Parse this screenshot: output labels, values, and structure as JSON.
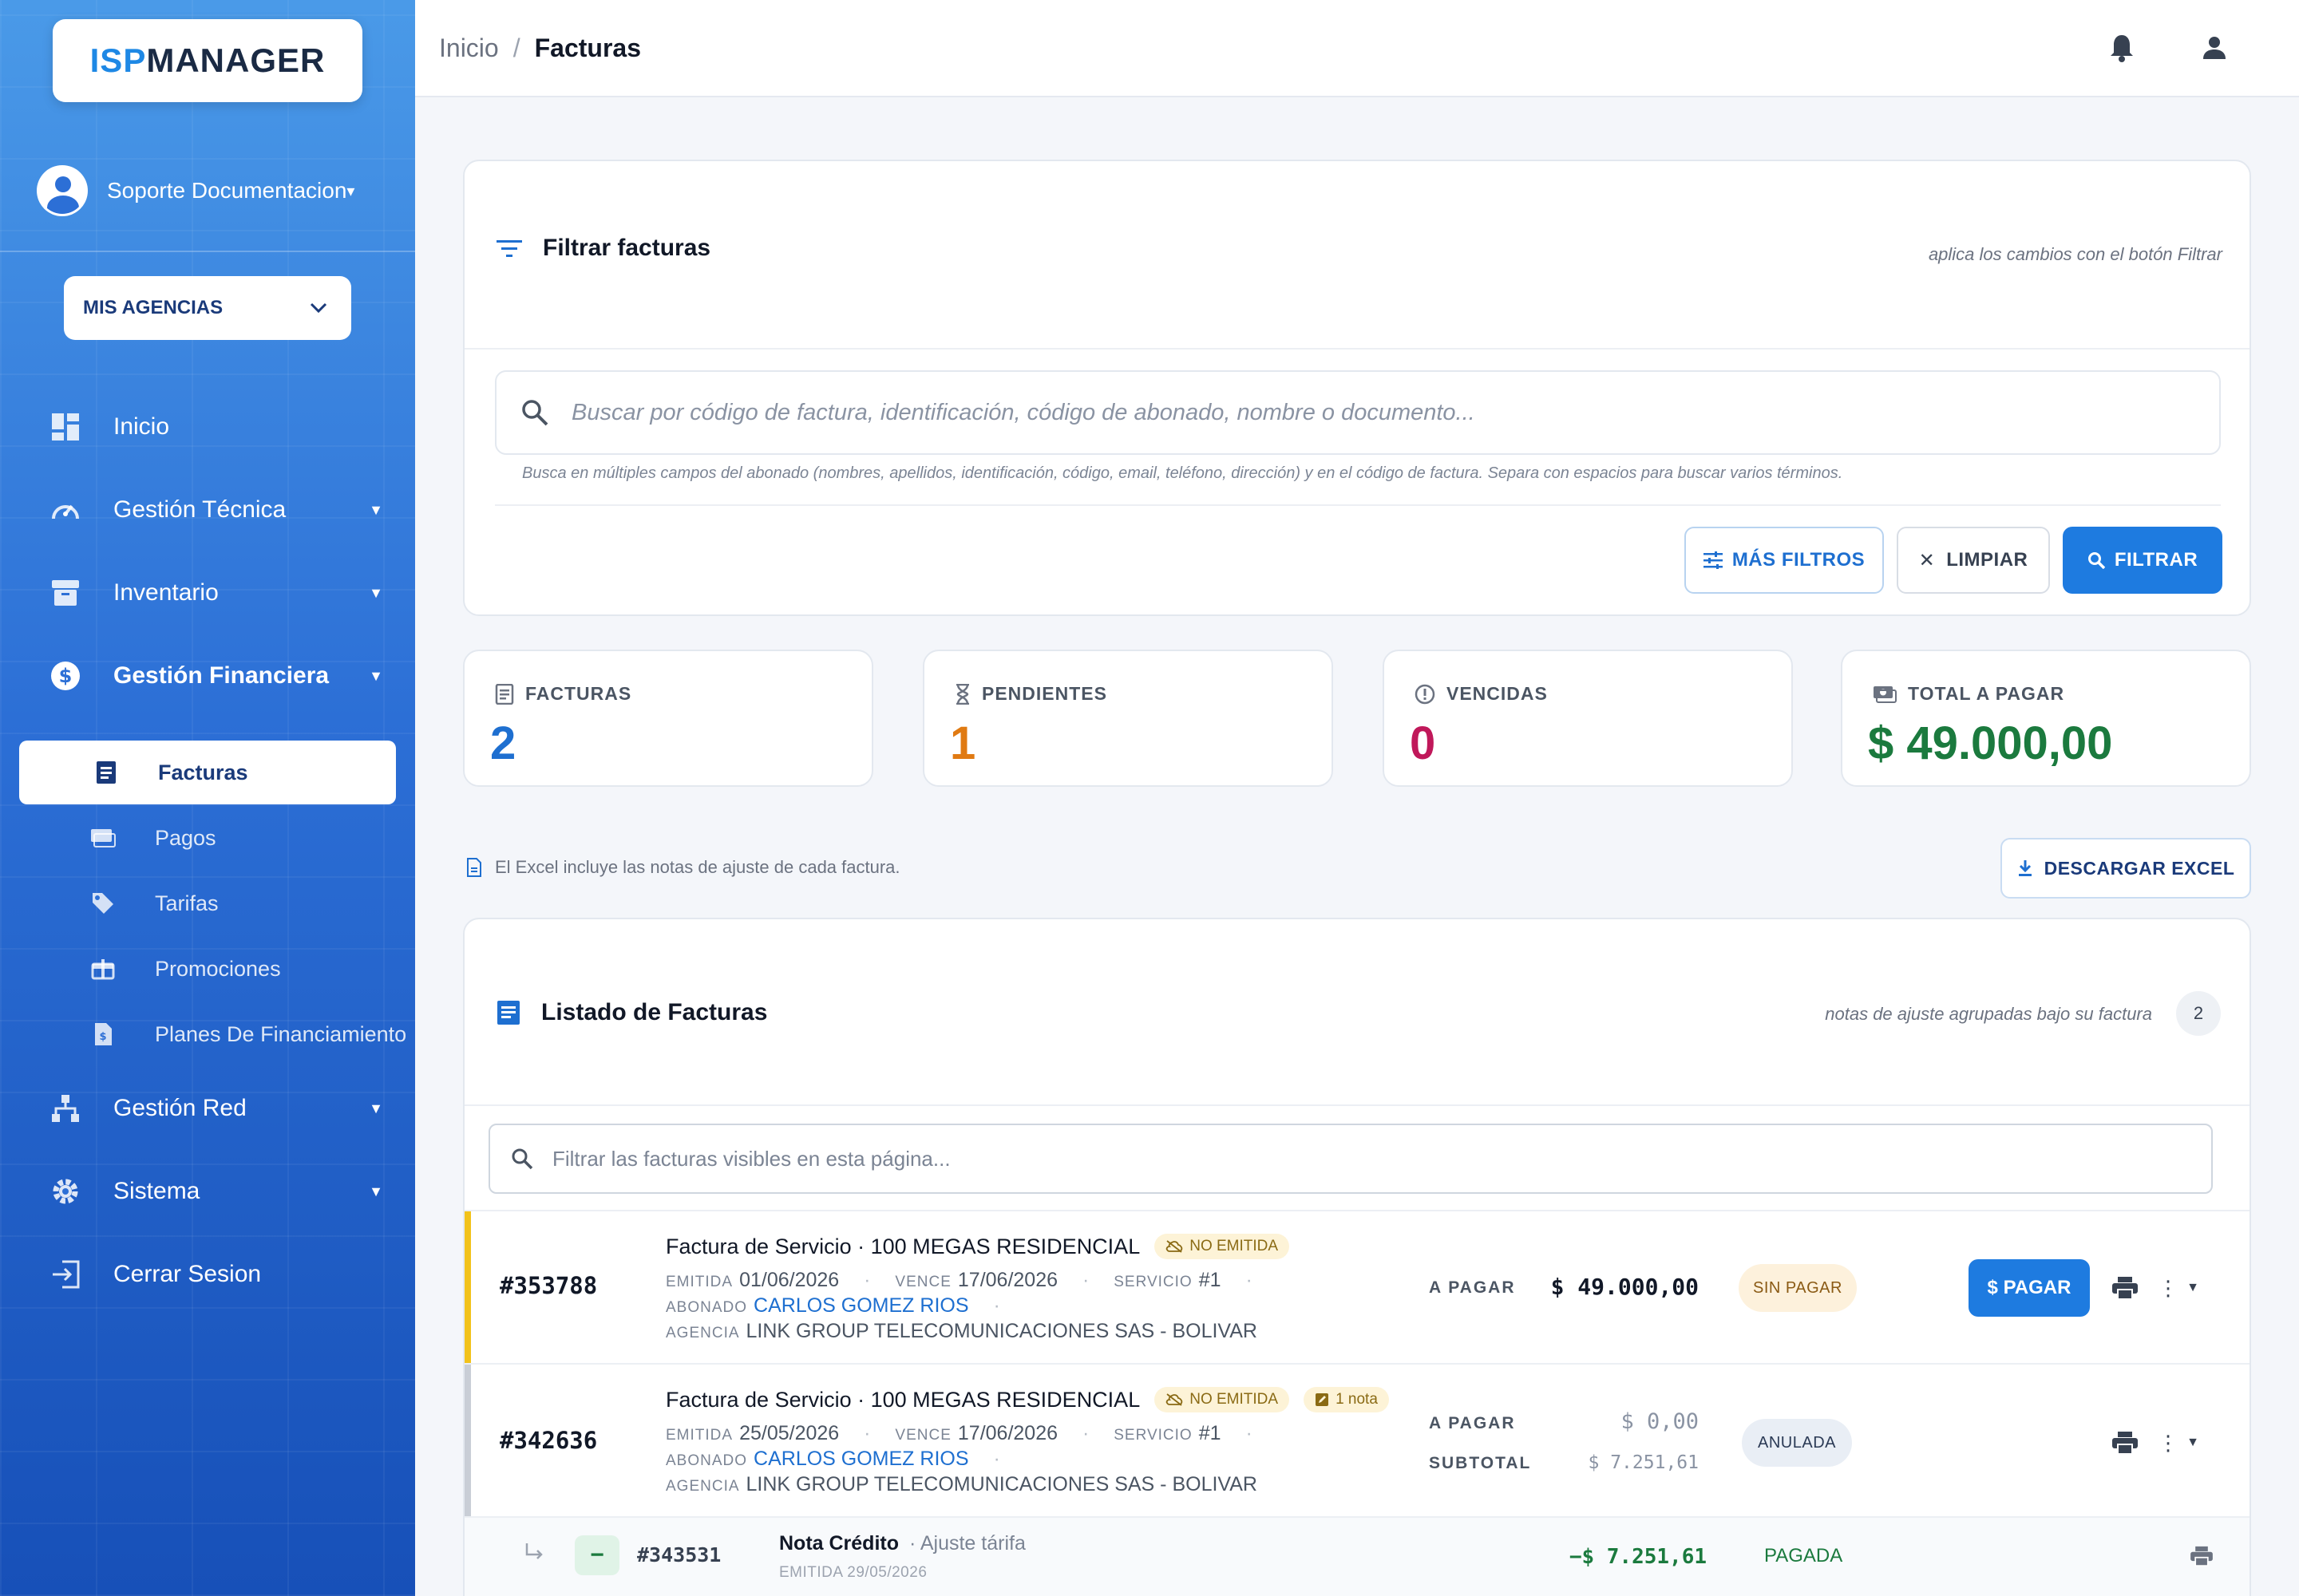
{
  "brand": {
    "logo_part1": "ISP",
    "logo_part2": "MANAGER"
  },
  "sidebar": {
    "user_name": "Soporte Documentacion",
    "agency_label": "MIS AGENCIAS",
    "items": [
      {
        "label": "Inicio",
        "icon": "dashboard-icon"
      },
      {
        "label": "Gestión Técnica",
        "icon": "gauge-icon"
      },
      {
        "label": "Inventario",
        "icon": "archive-icon"
      },
      {
        "label": "Gestión Financiera",
        "icon": "dollar-icon"
      },
      {
        "label": "Gestión Red",
        "icon": "network-icon"
      },
      {
        "label": "Sistema",
        "icon": "gear-icon"
      },
      {
        "label": "Cerrar Sesion",
        "icon": "logout-icon"
      }
    ],
    "finance_sub": [
      {
        "label": "Facturas",
        "icon": "invoice-icon",
        "active": true
      },
      {
        "label": "Pagos",
        "icon": "payments-icon"
      },
      {
        "label": "Tarifas",
        "icon": "tag-icon"
      },
      {
        "label": "Promociones",
        "icon": "gift-icon"
      },
      {
        "label": "Planes De Financiamiento",
        "icon": "document-icon"
      }
    ]
  },
  "topbar": {
    "crumb_home": "Inicio",
    "crumb_sep": "/",
    "crumb_current": "Facturas"
  },
  "filter": {
    "title": "Filtrar facturas",
    "hint": "aplica los cambios con el botón Filtrar",
    "search_placeholder": "Buscar por código de factura, identificación, código de abonado, nombre o documento...",
    "search_help": "Busca en múltiples campos del abonado (nombres, apellidos, identificación, código, email, teléfono, dirección) y en el código de factura. Separa con espacios para buscar varios términos.",
    "btn_more": "MÁS FILTROS",
    "btn_clear": "LIMPIAR",
    "btn_filter": "FILTRAR"
  },
  "stats": [
    {
      "label": "FACTURAS",
      "value": "2",
      "color": "#1e6fd0"
    },
    {
      "label": "PENDIENTES",
      "value": "1",
      "color": "#e07a12"
    },
    {
      "label": "VENCIDAS",
      "value": "0",
      "color": "#c0185a"
    },
    {
      "label": "TOTAL A PAGAR",
      "value": "$ 49.000,00",
      "color": "#1b7a3e"
    }
  ],
  "excel": {
    "note": "El Excel incluye las notas de ajuste de cada factura.",
    "button": "DESCARGAR EXCEL"
  },
  "list": {
    "title": "Listado de Facturas",
    "hint": "notas de ajuste agrupadas bajo su factura",
    "count": "2",
    "filter_placeholder": "Filtrar las facturas visibles en esta página...",
    "invoices": [
      {
        "code": "#353788",
        "title": "Factura de Servicio · 100 MEGAS RESIDENCIAL",
        "badge": "NO EMITIDA",
        "emitida_label": "EMITIDA",
        "emitida": "01/06/2026",
        "vence_label": "VENCE",
        "vence": "17/06/2026",
        "servicio_label": "SERVICIO",
        "servicio": "#1",
        "abonado_label": "ABONADO",
        "abonado": "CARLOS GOMEZ RIOS",
        "agencia_label": "AGENCIA",
        "agencia": "LINK GROUP TELECOMUNICACIONES SAS - BOLIVAR",
        "amount_label": "A PAGAR",
        "amount": "$ 49.000,00",
        "status": "SIN PAGAR",
        "pay_label": "$ PAGAR",
        "accent": "#f2c21b"
      },
      {
        "code": "#342636",
        "title": "Factura de Servicio · 100 MEGAS RESIDENCIAL",
        "badge": "NO EMITIDA",
        "nota_badge": "1 nota",
        "emitida_label": "EMITIDA",
        "emitida": "25/05/2026",
        "vence_label": "VENCE",
        "vence": "17/06/2026",
        "servicio_label": "SERVICIO",
        "servicio": "#1",
        "abonado_label": "ABONADO",
        "abonado": "CARLOS GOMEZ RIOS",
        "agencia_label": "AGENCIA",
        "agencia": "LINK GROUP TELECOMUNICACIONES SAS - BOLIVAR",
        "amount_label": "A PAGAR",
        "amount": "$ 0,00",
        "subtotal_label": "SUBTOTAL",
        "subtotal": "$ 7.251,61",
        "status": "ANULADA",
        "accent": "#c9ced6"
      }
    ],
    "nota": {
      "code": "#343531",
      "title": "Nota Crédito",
      "subtitle": "· Ajuste tárifa",
      "emitida": "EMITIDA 29/05/2026",
      "amount": "−$ 7.251,61",
      "status": "PAGADA",
      "sign": "−"
    }
  }
}
